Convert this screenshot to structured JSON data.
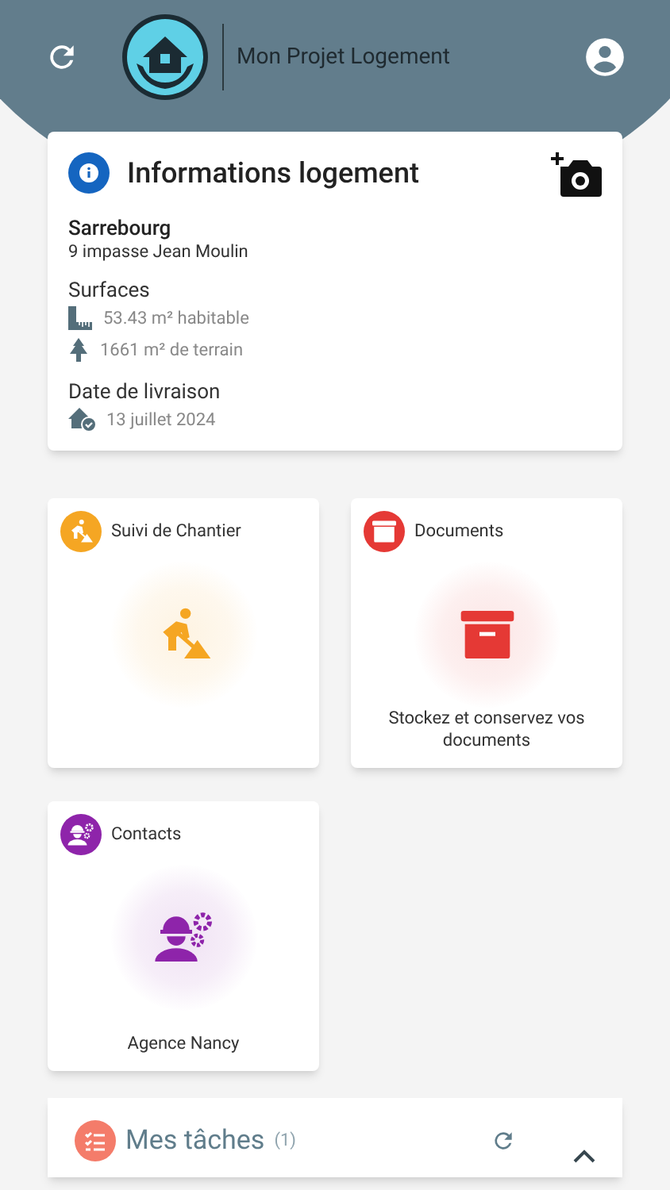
{
  "header": {
    "title": "Mon Projet Logement"
  },
  "info_card": {
    "title": "Informations logement",
    "city": "Sarrebourg",
    "address": "9 impasse Jean Moulin",
    "surfaces_label": "Surfaces",
    "living_area": "53.43 m² habitable",
    "land_area": "1661 m² de terrain",
    "delivery_label": "Date de livraison",
    "delivery_date": "13 juillet 2024"
  },
  "tiles": [
    {
      "kind": "worksite",
      "title": "Suivi de Chantier",
      "color": "#f5a623"
    },
    {
      "kind": "documents",
      "title": "Documents",
      "color": "#e53935",
      "caption": "Stockez et conservez vos documents"
    },
    {
      "kind": "contacts",
      "title": "Contacts",
      "color": "#8e24aa",
      "caption": "Agence Nancy"
    }
  ],
  "tasks": {
    "title": "Mes tâches",
    "count": "(1)",
    "expanded": true
  }
}
